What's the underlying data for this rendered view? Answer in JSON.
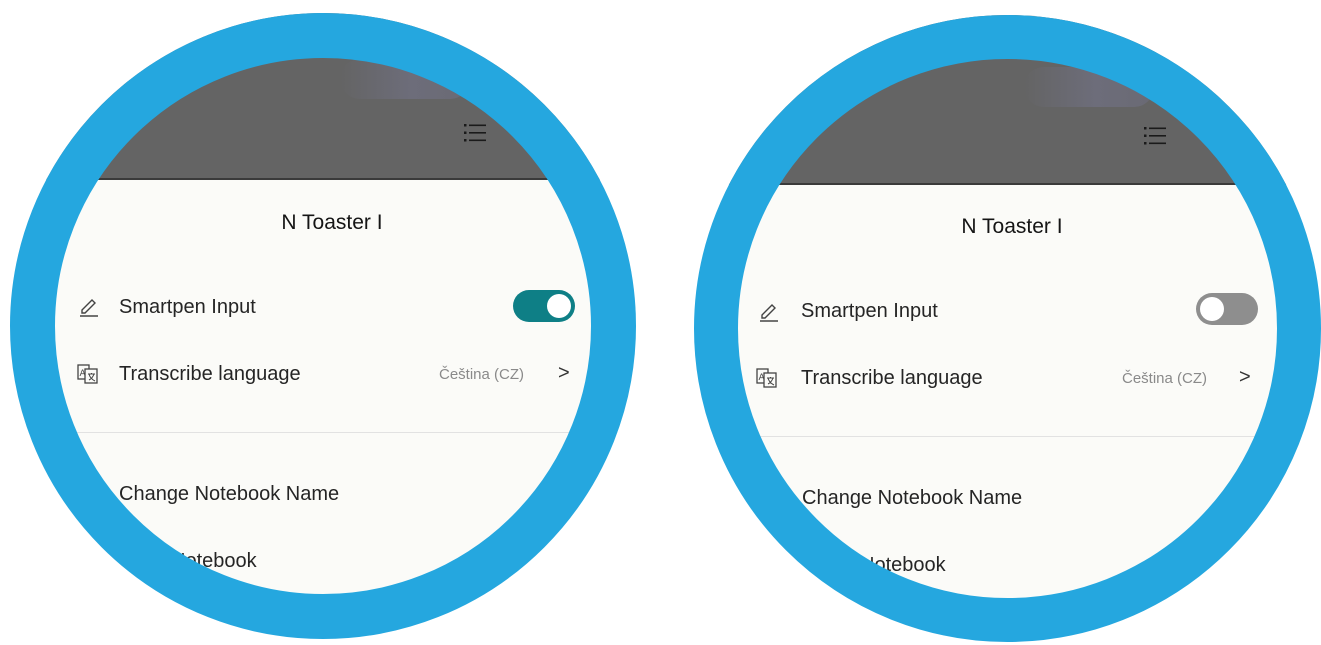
{
  "colors": {
    "ring": "#25a7df",
    "header_bar": "#646464",
    "panel_bg": "#fbfbf8",
    "toggle_on": "#0e7f86",
    "toggle_off": "#8e8e8e"
  },
  "panels": [
    {
      "device_name": "N Toaster I",
      "menu_icon": "list-icon",
      "smartpen": {
        "icon": "pencil-icon",
        "label": "Smartpen Input",
        "enabled": true
      },
      "transcribe": {
        "icon": "translate-icon",
        "label": "Transcribe language",
        "value": "Čeština (CZ)",
        "chevron": ">"
      },
      "change_name": {
        "label": "Change Notebook Name"
      },
      "notebook": {
        "label": "Notebook"
      }
    },
    {
      "device_name": "N Toaster I",
      "menu_icon": "list-icon",
      "smartpen": {
        "icon": "pencil-icon",
        "label": "Smartpen Input",
        "enabled": false
      },
      "transcribe": {
        "icon": "translate-icon",
        "label": "Transcribe language",
        "value": "Čeština (CZ)",
        "chevron": ">"
      },
      "change_name": {
        "label": "Change Notebook Name"
      },
      "notebook": {
        "label": "Notebook"
      }
    }
  ]
}
